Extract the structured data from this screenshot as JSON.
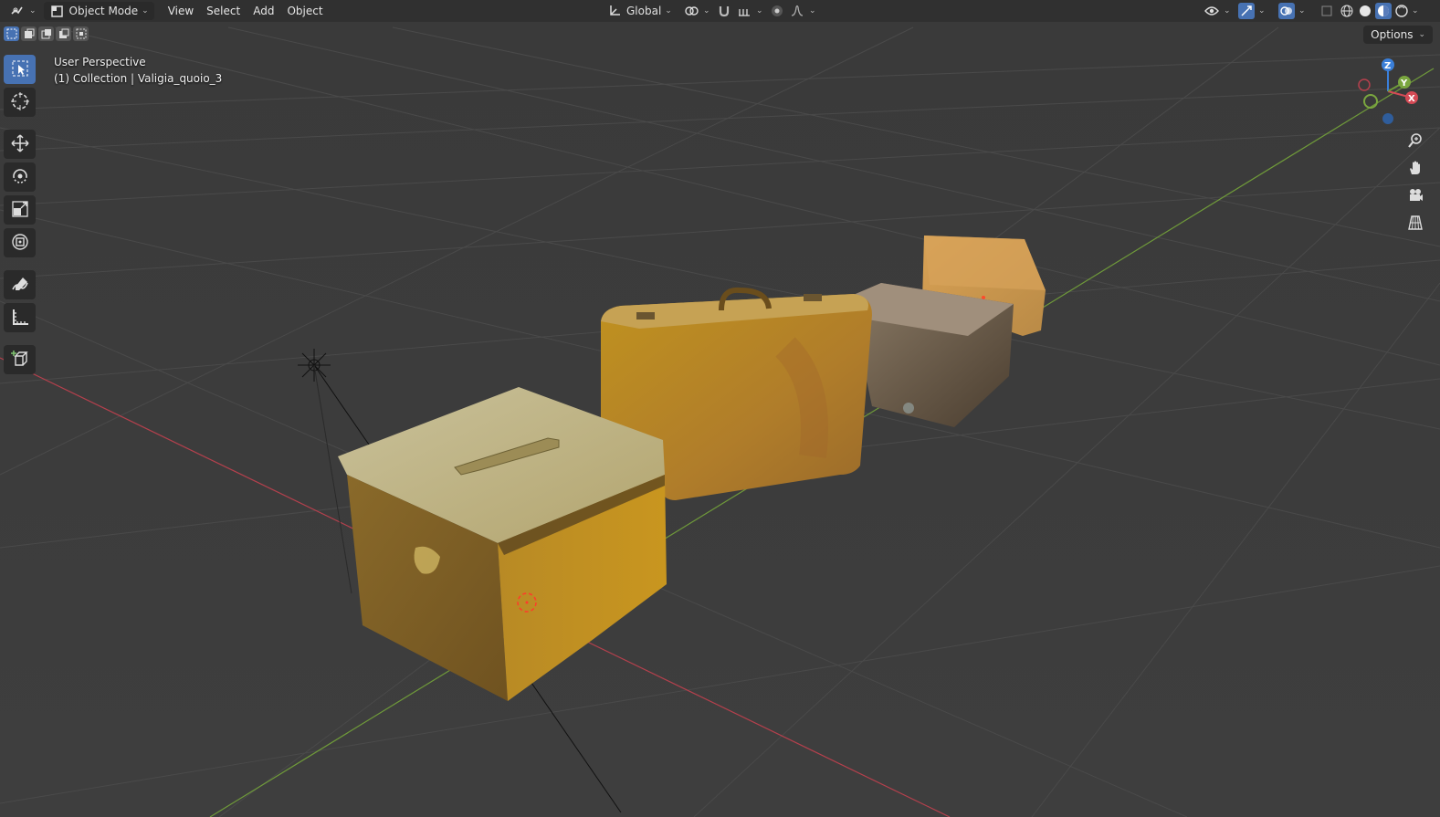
{
  "header": {
    "editor_type_icon": "editor-type-icon",
    "mode": "Object Mode",
    "menus": [
      "View",
      "Select",
      "Add",
      "Object"
    ],
    "transform_orientation": "Global"
  },
  "subbar": {
    "options_label": "Options"
  },
  "viewport": {
    "perspective_label": "User Perspective",
    "collection_label": "(1) Collection | Valigia_quoio_3",
    "axes": {
      "x": "X",
      "y": "Y",
      "z": "Z"
    }
  },
  "colors": {
    "header_bg": "#303030",
    "viewport_bg": "#3d3d3d",
    "accent": "#4772b3",
    "x_axis": "#b5404d",
    "y_axis": "#6f9a3a",
    "z_axis": "#3a7fd9"
  },
  "toolbar_icons": [
    "select-box-icon",
    "cursor-icon",
    "move-icon",
    "rotate-icon",
    "scale-icon",
    "transform-icon",
    "annotate-icon",
    "measure-icon",
    "add-cube-icon"
  ],
  "nav_icons": [
    "zoom-icon",
    "pan-hand-icon",
    "camera-icon",
    "grid-view-icon"
  ]
}
